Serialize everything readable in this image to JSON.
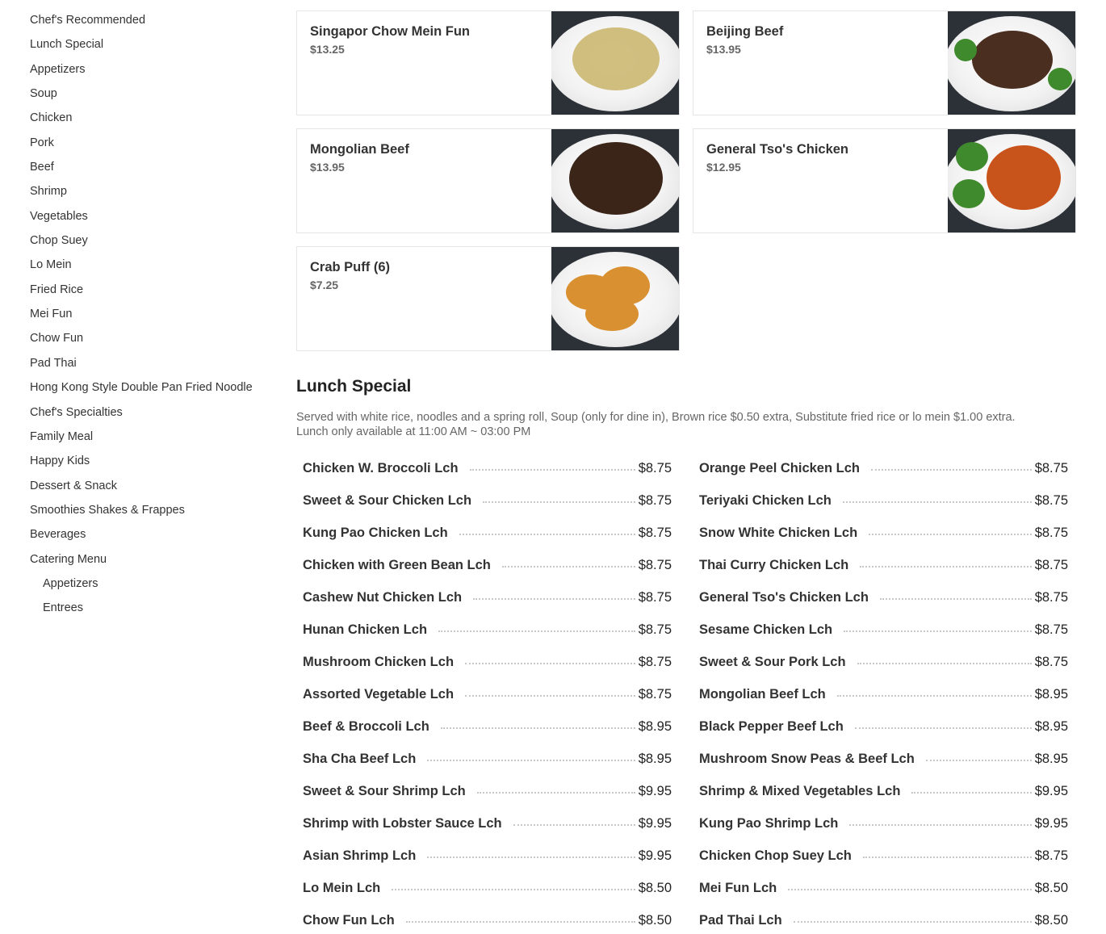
{
  "sidebar": {
    "items": [
      {
        "label": "Chef's Recommended"
      },
      {
        "label": "Lunch Special"
      },
      {
        "label": "Appetizers"
      },
      {
        "label": "Soup"
      },
      {
        "label": "Chicken"
      },
      {
        "label": "Pork"
      },
      {
        "label": "Beef"
      },
      {
        "label": "Shrimp"
      },
      {
        "label": "Vegetables"
      },
      {
        "label": "Chop Suey"
      },
      {
        "label": "Lo Mein"
      },
      {
        "label": "Fried Rice"
      },
      {
        "label": "Mei Fun"
      },
      {
        "label": "Chow Fun"
      },
      {
        "label": "Pad Thai"
      },
      {
        "label": "Hong Kong Style Double Pan Fried Noodle"
      },
      {
        "label": "Chef's Specialties"
      },
      {
        "label": "Family Meal"
      },
      {
        "label": "Happy Kids"
      },
      {
        "label": "Dessert & Snack"
      },
      {
        "label": "Smoothies Shakes & Frappes"
      },
      {
        "label": "Beverages"
      },
      {
        "label": "Catering Menu"
      }
    ],
    "subitems": [
      {
        "label": "Appetizers"
      },
      {
        "label": "Entrees"
      }
    ]
  },
  "featured": [
    {
      "name": "Singapor Chow Mein Fun",
      "price": "$13.25",
      "food_color": "#c9b46a"
    },
    {
      "name": "Beijing Beef",
      "price": "$13.95",
      "food_color": "#4a2e1f"
    },
    {
      "name": "Mongolian Beef",
      "price": "$13.95",
      "food_color": "#3b2418"
    },
    {
      "name": "General Tso's Chicken",
      "price": "$12.95",
      "food_color": "#c8541c"
    },
    {
      "name": "Crab Puff (6)",
      "price": "$7.25",
      "food_color": "#d99030"
    }
  ],
  "lunch_special": {
    "title": "Lunch Special",
    "description": "Served with white rice, noodles and a spring roll, Soup (only for dine in), Brown rice $0.50 extra, Substitute fried rice or lo mein $1.00 extra.",
    "availability": "Lunch only available at 11:00 AM ~ 03:00 PM",
    "left_items": [
      {
        "name": "Chicken W. Broccoli Lch",
        "price": "$8.75"
      },
      {
        "name": "Sweet & Sour Chicken Lch",
        "price": "$8.75"
      },
      {
        "name": "Kung Pao Chicken Lch",
        "price": "$8.75"
      },
      {
        "name": "Chicken with Green Bean Lch",
        "price": "$8.75"
      },
      {
        "name": "Cashew Nut Chicken Lch",
        "price": "$8.75"
      },
      {
        "name": "Hunan Chicken Lch",
        "price": "$8.75"
      },
      {
        "name": "Mushroom Chicken Lch",
        "price": "$8.75"
      },
      {
        "name": "Assorted Vegetable Lch",
        "price": "$8.75"
      },
      {
        "name": "Beef & Broccoli Lch",
        "price": "$8.95"
      },
      {
        "name": "Sha Cha Beef Lch",
        "price": "$8.95"
      },
      {
        "name": "Sweet & Sour Shrimp Lch",
        "price": "$9.95"
      },
      {
        "name": "Shrimp with Lobster Sauce Lch",
        "price": "$9.95"
      },
      {
        "name": "Asian Shrimp Lch",
        "price": "$9.95"
      },
      {
        "name": "Lo Mein Lch",
        "price": "$8.50"
      },
      {
        "name": "Chow Fun Lch",
        "price": "$8.50"
      }
    ],
    "right_items": [
      {
        "name": "Orange Peel Chicken Lch",
        "price": "$8.75"
      },
      {
        "name": "Teriyaki Chicken Lch",
        "price": "$8.75"
      },
      {
        "name": "Snow White Chicken Lch",
        "price": "$8.75"
      },
      {
        "name": "Thai Curry Chicken Lch",
        "price": "$8.75"
      },
      {
        "name": "General Tso's Chicken Lch",
        "price": "$8.75"
      },
      {
        "name": "Sesame Chicken Lch",
        "price": "$8.75"
      },
      {
        "name": "Sweet & Sour Pork Lch",
        "price": "$8.75"
      },
      {
        "name": "Mongolian Beef Lch",
        "price": "$8.95"
      },
      {
        "name": "Black Pepper Beef Lch",
        "price": "$8.95"
      },
      {
        "name": "Mushroom Snow Peas & Beef Lch",
        "price": "$8.95"
      },
      {
        "name": "Shrimp & Mixed Vegetables Lch",
        "price": "$9.95"
      },
      {
        "name": "Kung Pao Shrimp Lch",
        "price": "$9.95"
      },
      {
        "name": "Chicken Chop Suey Lch",
        "price": "$8.75"
      },
      {
        "name": "Mei Fun Lch",
        "price": "$8.50"
      },
      {
        "name": "Pad Thai Lch",
        "price": "$8.50"
      }
    ]
  }
}
